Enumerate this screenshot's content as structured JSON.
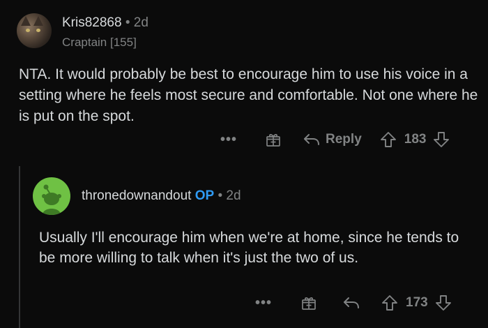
{
  "comment": {
    "username": "Kris82868",
    "separator": "•",
    "time": "2d",
    "flair": "Craptain [155]",
    "body": "NTA. It would probably be best to encourage him to use his voice in a setting where he feels most secure and comfortable. Not one where he is put on the spot.",
    "actions": {
      "more": "•••",
      "award_icon": "gift-icon",
      "reply_icon": "reply-arrow-icon",
      "reply_label": "Reply",
      "upvote_icon": "upvote-arrow-icon",
      "score": "183",
      "downvote_icon": "downvote-arrow-icon"
    }
  },
  "reply": {
    "username": "thronedownandout",
    "op_badge": "OP",
    "separator": "•",
    "time": "2d",
    "body": "Usually I'll encourage him when we're at home, since he tends to be more willing to talk when it's just the two of us.",
    "actions": {
      "more": "•••",
      "award_icon": "gift-icon",
      "reply_icon": "reply-arrow-icon",
      "upvote_icon": "upvote-arrow-icon",
      "score": "173",
      "downvote_icon": "downvote-arrow-icon"
    }
  },
  "colors": {
    "background": "#0b0b0b",
    "text": "#d7dadc",
    "muted": "#818384",
    "op_blue": "#2f9bf5",
    "snoo_green": "#6fc144"
  }
}
